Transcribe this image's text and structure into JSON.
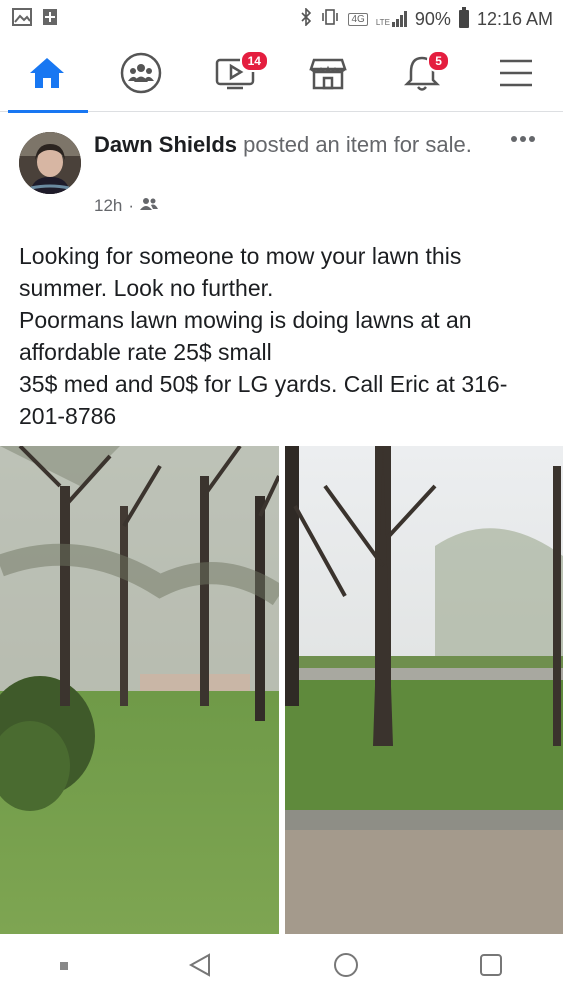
{
  "status_bar": {
    "battery": "90%",
    "time": "12:16 AM",
    "network": "4G",
    "lte": "LTE"
  },
  "nav": {
    "watch_badge": "14",
    "notifications_badge": "5"
  },
  "post": {
    "author": "Dawn Shields",
    "action": " posted an item for sale.",
    "time": "12h",
    "separator": "·",
    "text": [
      "Looking for someone to mow your lawn this summer. Look no further.",
      "Poormans lawn mowing is doing lawns at an affordable rate 25$ small",
      "35$ med and 50$ for LG yards. Call Eric at 316-201-8786"
    ]
  },
  "colors": {
    "accent": "#1877f2",
    "badge": "#e41e3f",
    "secondary_text": "#65676b"
  },
  "icons": [
    "image-icon",
    "plus-box-icon",
    "bluetooth-icon",
    "vibrate-icon",
    "signal-icon",
    "battery-icon",
    "home-icon",
    "groups-icon",
    "watch-icon",
    "marketplace-icon",
    "bell-icon",
    "menu-icon",
    "friends-audience-icon",
    "more-options-icon",
    "back-icon",
    "home-circle-icon",
    "recents-icon"
  ]
}
